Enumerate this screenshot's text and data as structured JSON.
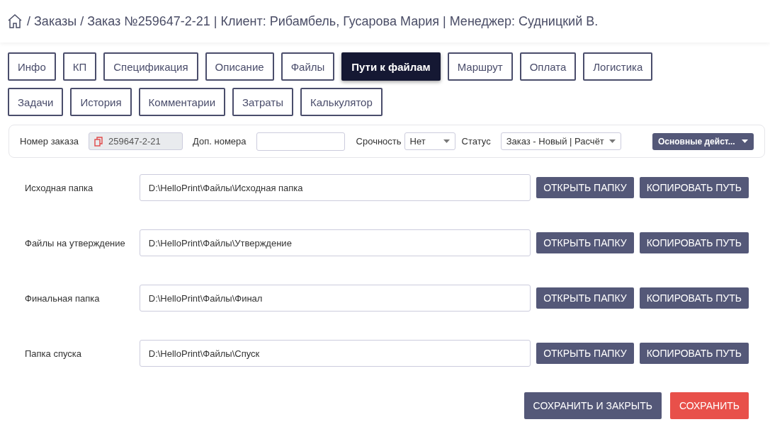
{
  "breadcrumb": {
    "text": "/ Заказы / Заказ №259647-2-21 | Клиент: Рибамбель, Гусарова Мария | Менеджер: Судницкий В."
  },
  "tabs": [
    {
      "label": "Инфо",
      "selected": false
    },
    {
      "label": "КП",
      "selected": false
    },
    {
      "label": "Спецификация",
      "selected": false
    },
    {
      "label": "Описание",
      "selected": false
    },
    {
      "label": "Файлы",
      "selected": false
    },
    {
      "label": "Пути к файлам",
      "selected": true
    },
    {
      "label": "Маршрут",
      "selected": false
    },
    {
      "label": "Оплата",
      "selected": false
    },
    {
      "label": "Логистика",
      "selected": false
    },
    {
      "label": "Задачи",
      "selected": false
    },
    {
      "label": "История",
      "selected": false
    },
    {
      "label": "Комментарии",
      "selected": false
    },
    {
      "label": "Затраты",
      "selected": false
    },
    {
      "label": "Калькулятор",
      "selected": false
    }
  ],
  "toolbar": {
    "order_label": "Номер заказа",
    "order_value": "259647-2-21",
    "extra_label": "Доп. номера",
    "urgency_label": "Срочность",
    "urgency_value": "Нет",
    "status_label": "Статус",
    "status_value": "Заказ - Новый | Расчёт",
    "actions_button": "Основные дейст..."
  },
  "paths": [
    {
      "label": "Исходная папка",
      "value": "D:\\HelloPrint\\Файлы\\Исходная папка",
      "open_button": "ОТКРЫТЬ ПАПКУ",
      "copy_button": "КОПИРОВАТЬ ПУТЬ"
    },
    {
      "label": "Файлы на утверждение",
      "value": "D:\\HelloPrint\\Файлы\\Утверждение",
      "open_button": "ОТКРЫТЬ ПАПКУ",
      "copy_button": "КОПИРОВАТЬ ПУТЬ"
    },
    {
      "label": "Финальная папка",
      "value": "D:\\HelloPrint\\Файлы\\Финал",
      "open_button": "ОТКРЫТЬ ПАПКУ",
      "copy_button": "КОПИРОВАТЬ ПУТЬ"
    },
    {
      "label": "Папка спуска",
      "value": "D:\\HelloPrint\\Файлы\\Спуск",
      "open_button": "ОТКРЫТЬ ПАПКУ",
      "copy_button": "КОПИРОВАТЬ ПУТЬ"
    }
  ],
  "footer": {
    "save_close_button": "СОХРАНИТЬ И ЗАКРЫТЬ",
    "save_button": "СОХРАНИТЬ"
  }
}
